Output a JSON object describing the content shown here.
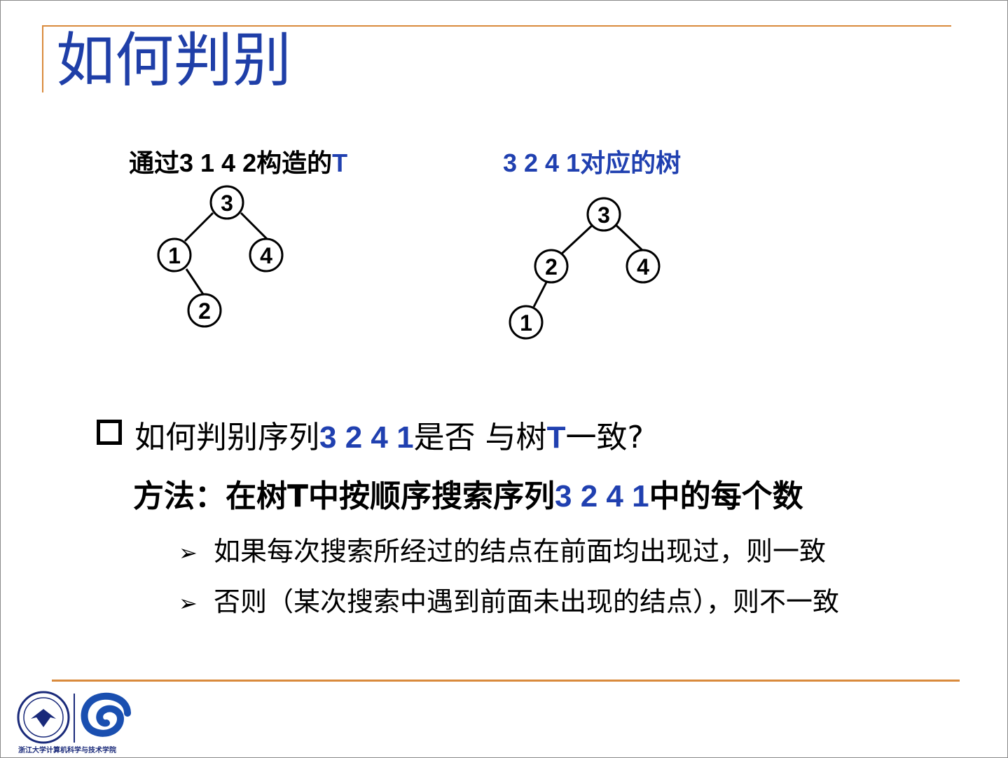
{
  "slide": {
    "title": "如何判别",
    "left_caption": {
      "prefix": "通过3 1 4 2构造的",
      "suffix": "T"
    },
    "right_caption": {
      "prefix": "3 2 4 1",
      "suffix": "对应的树"
    },
    "left_tree": {
      "nodes": [
        "3",
        "1",
        "4",
        "2"
      ],
      "edges": [
        [
          "3",
          "1"
        ],
        [
          "3",
          "4"
        ],
        [
          "1",
          "2"
        ]
      ]
    },
    "right_tree": {
      "nodes": [
        "3",
        "2",
        "4",
        "1"
      ],
      "edges": [
        [
          "3",
          "2"
        ],
        [
          "3",
          "4"
        ],
        [
          "2",
          "1"
        ]
      ]
    },
    "question": {
      "part1": "如何判别序列",
      "seq": "3 2 4 1",
      "part2": "是否 与树",
      "tree": "T",
      "part3": "一致?"
    },
    "method": {
      "part1": "方法：在树T中按顺序搜索序列",
      "seq": "3 2 4 1",
      "part2": "中的每个数"
    },
    "bullets": [
      "如果每次搜索所经过的结点在前面均出现过，则一致",
      "否则（某次搜索中遇到前面未出现的结点），则不一致"
    ],
    "bullet_marker": "➢",
    "footer": {
      "institution": "浙江大学计算机科学与技术学院"
    },
    "colors": {
      "title": "#1f3fa8",
      "accent_line": "#d98a3c",
      "highlight": "#2040b0"
    }
  }
}
